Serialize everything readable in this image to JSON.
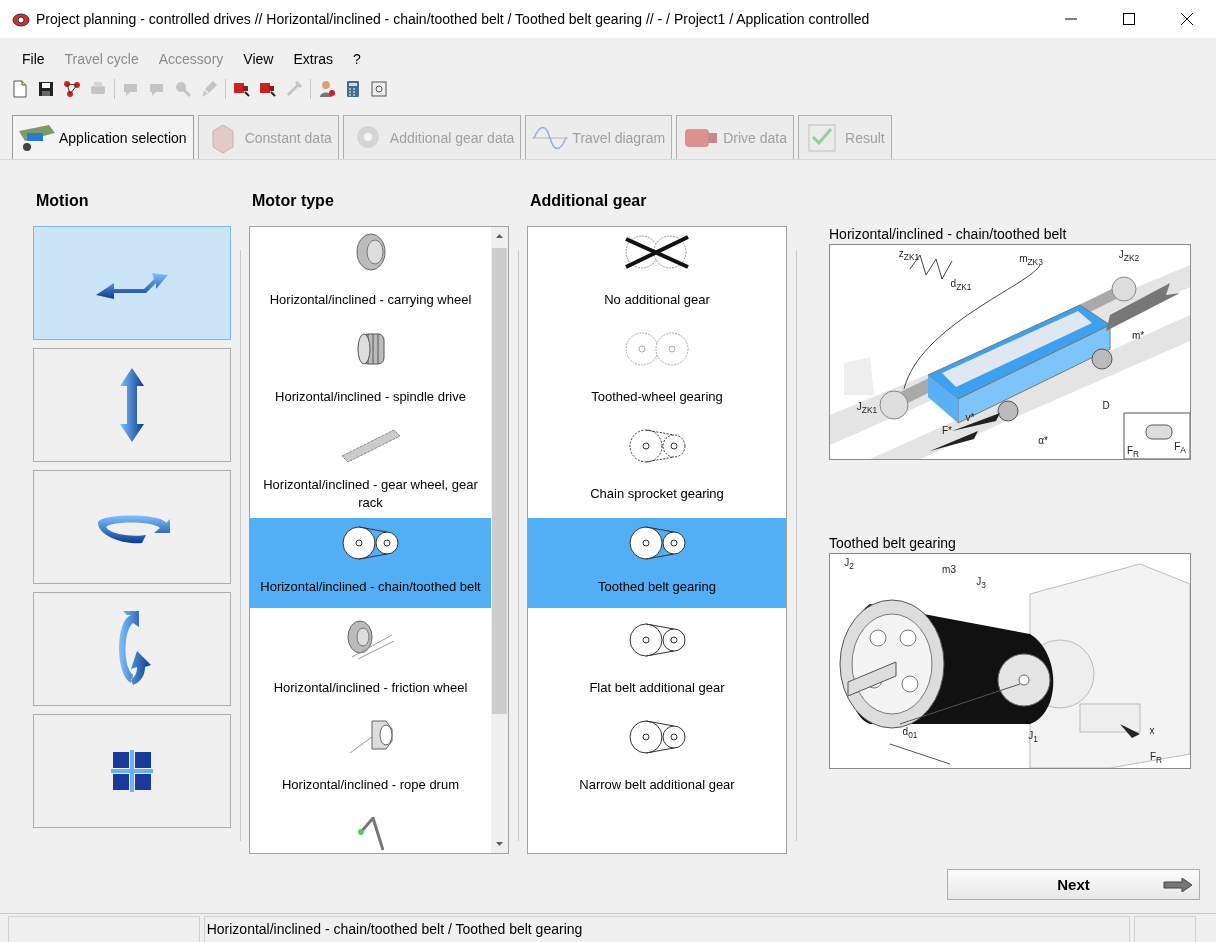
{
  "window": {
    "title": "Project planning - controlled drives // Horizontal/inclined - chain/toothed belt / Toothed belt gearing // - / Project1 / Application  controlled"
  },
  "menu": [
    {
      "label": "File",
      "disabled": false
    },
    {
      "label": "Travel cycle",
      "disabled": true
    },
    {
      "label": "Accessory",
      "disabled": true
    },
    {
      "label": "View",
      "disabled": false
    },
    {
      "label": "Extras",
      "disabled": false
    },
    {
      "label": "?",
      "disabled": false
    }
  ],
  "toolbar": [
    [
      {
        "kind": "document",
        "disabled": false
      },
      {
        "kind": "save",
        "disabled": false
      },
      {
        "kind": "network",
        "disabled": false
      },
      {
        "kind": "printer",
        "disabled": true
      }
    ],
    [
      {
        "kind": "bubble",
        "disabled": true
      },
      {
        "kind": "bubble",
        "disabled": true
      },
      {
        "kind": "zoom",
        "disabled": true
      },
      {
        "kind": "brush",
        "disabled": true
      }
    ],
    [
      {
        "kind": "motor",
        "disabled": false
      },
      {
        "kind": "motor",
        "disabled": false
      },
      {
        "kind": "tool",
        "disabled": true
      }
    ],
    [
      {
        "kind": "user",
        "disabled": false
      },
      {
        "kind": "calculator",
        "disabled": false
      },
      {
        "kind": "disk",
        "disabled": false
      }
    ]
  ],
  "tabs": [
    {
      "label": "Application selection",
      "kind": "trolley",
      "selected": true,
      "disabled": false
    },
    {
      "label": "Constant data",
      "kind": "crate",
      "selected": false,
      "disabled": true
    },
    {
      "label": "Additional gear data",
      "kind": "gear",
      "selected": false,
      "disabled": true
    },
    {
      "label": "Travel diagram",
      "kind": "curve",
      "selected": false,
      "disabled": true
    },
    {
      "label": "Drive data",
      "kind": "motor",
      "selected": false,
      "disabled": true
    },
    {
      "label": "Result",
      "kind": "checklist",
      "selected": false,
      "disabled": true
    }
  ],
  "motion": {
    "heading": "Motion",
    "options": [
      {
        "kind": "horizontal",
        "selected": true
      },
      {
        "kind": "vertical",
        "selected": false
      },
      {
        "kind": "rotary",
        "selected": false
      },
      {
        "kind": "swivel",
        "selected": false
      },
      {
        "kind": "custom",
        "selected": false
      }
    ]
  },
  "motor_type": {
    "heading": "Motor type",
    "items": [
      {
        "label": "Horizontal/inclined - carrying wheel",
        "kind": "wheel",
        "selected": false
      },
      {
        "label": "Horizontal/inclined - spindle drive",
        "kind": "spindle",
        "selected": false
      },
      {
        "label": "Horizontal/inclined - gear wheel, gear rack",
        "kind": "rack",
        "selected": false
      },
      {
        "label": "Horizontal/inclined - chain/toothed belt",
        "kind": "belt",
        "selected": true
      },
      {
        "label": "Horizontal/inclined - friction wheel",
        "kind": "friction",
        "selected": false
      },
      {
        "label": "Horizontal/inclined - rope drum",
        "kind": "rope",
        "selected": false
      },
      {
        "kind": "crank",
        "selected": false
      }
    ]
  },
  "additional_gear": {
    "heading": "Additional gear",
    "items": [
      {
        "label": "No additional gear",
        "kind": "none",
        "selected": false
      },
      {
        "label": "Toothed-wheel gearing",
        "kind": "toothed",
        "selected": false
      },
      {
        "label": "Chain sprocket gearing",
        "kind": "chain",
        "selected": false
      },
      {
        "label": "Toothed belt gearing",
        "kind": "belt",
        "selected": true
      },
      {
        "label": "Flat belt additional gear",
        "kind": "flat",
        "selected": false
      },
      {
        "label": "Narrow belt additional gear",
        "kind": "narrow",
        "selected": false
      }
    ]
  },
  "diagrams": [
    {
      "title": "Horizontal/inclined - chain/toothed belt",
      "kind": "trolley",
      "labels": [
        "z$_{ZK1}$",
        "m$_{ZK3}$",
        "J$_{ZK2}$",
        "d$_{ZK1}$",
        "m*",
        "J$_{ZK1}$",
        "D",
        "F*",
        "v*",
        "α*",
        "F$_{R}$",
        "F$_{A}$"
      ]
    },
    {
      "title": "Toothed belt gearing",
      "kind": "belt",
      "labels": [
        "J$_{2}$",
        "m3",
        "J$_{3}$",
        "d$_{01}$",
        "J$_{1}$",
        "x",
        "F$_{R}$"
      ]
    }
  ],
  "next_button": {
    "label": "Next"
  },
  "status_bar": {
    "text": "Horizontal/inclined - chain/toothed belt / Toothed belt gearing"
  }
}
